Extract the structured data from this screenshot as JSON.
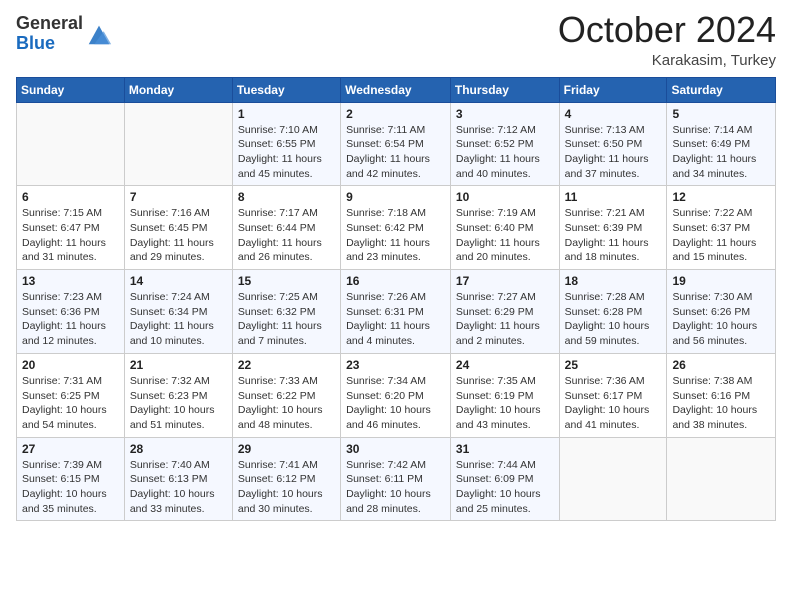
{
  "logo": {
    "line1": "General",
    "line2": "Blue"
  },
  "header": {
    "month": "October 2024",
    "location": "Karakasim, Turkey"
  },
  "days_of_week": [
    "Sunday",
    "Monday",
    "Tuesday",
    "Wednesday",
    "Thursday",
    "Friday",
    "Saturday"
  ],
  "weeks": [
    [
      {
        "day": "",
        "info": ""
      },
      {
        "day": "",
        "info": ""
      },
      {
        "day": "1",
        "info": "Sunrise: 7:10 AM\nSunset: 6:55 PM\nDaylight: 11 hours and 45 minutes."
      },
      {
        "day": "2",
        "info": "Sunrise: 7:11 AM\nSunset: 6:54 PM\nDaylight: 11 hours and 42 minutes."
      },
      {
        "day": "3",
        "info": "Sunrise: 7:12 AM\nSunset: 6:52 PM\nDaylight: 11 hours and 40 minutes."
      },
      {
        "day": "4",
        "info": "Sunrise: 7:13 AM\nSunset: 6:50 PM\nDaylight: 11 hours and 37 minutes."
      },
      {
        "day": "5",
        "info": "Sunrise: 7:14 AM\nSunset: 6:49 PM\nDaylight: 11 hours and 34 minutes."
      }
    ],
    [
      {
        "day": "6",
        "info": "Sunrise: 7:15 AM\nSunset: 6:47 PM\nDaylight: 11 hours and 31 minutes."
      },
      {
        "day": "7",
        "info": "Sunrise: 7:16 AM\nSunset: 6:45 PM\nDaylight: 11 hours and 29 minutes."
      },
      {
        "day": "8",
        "info": "Sunrise: 7:17 AM\nSunset: 6:44 PM\nDaylight: 11 hours and 26 minutes."
      },
      {
        "day": "9",
        "info": "Sunrise: 7:18 AM\nSunset: 6:42 PM\nDaylight: 11 hours and 23 minutes."
      },
      {
        "day": "10",
        "info": "Sunrise: 7:19 AM\nSunset: 6:40 PM\nDaylight: 11 hours and 20 minutes."
      },
      {
        "day": "11",
        "info": "Sunrise: 7:21 AM\nSunset: 6:39 PM\nDaylight: 11 hours and 18 minutes."
      },
      {
        "day": "12",
        "info": "Sunrise: 7:22 AM\nSunset: 6:37 PM\nDaylight: 11 hours and 15 minutes."
      }
    ],
    [
      {
        "day": "13",
        "info": "Sunrise: 7:23 AM\nSunset: 6:36 PM\nDaylight: 11 hours and 12 minutes."
      },
      {
        "day": "14",
        "info": "Sunrise: 7:24 AM\nSunset: 6:34 PM\nDaylight: 11 hours and 10 minutes."
      },
      {
        "day": "15",
        "info": "Sunrise: 7:25 AM\nSunset: 6:32 PM\nDaylight: 11 hours and 7 minutes."
      },
      {
        "day": "16",
        "info": "Sunrise: 7:26 AM\nSunset: 6:31 PM\nDaylight: 11 hours and 4 minutes."
      },
      {
        "day": "17",
        "info": "Sunrise: 7:27 AM\nSunset: 6:29 PM\nDaylight: 11 hours and 2 minutes."
      },
      {
        "day": "18",
        "info": "Sunrise: 7:28 AM\nSunset: 6:28 PM\nDaylight: 10 hours and 59 minutes."
      },
      {
        "day": "19",
        "info": "Sunrise: 7:30 AM\nSunset: 6:26 PM\nDaylight: 10 hours and 56 minutes."
      }
    ],
    [
      {
        "day": "20",
        "info": "Sunrise: 7:31 AM\nSunset: 6:25 PM\nDaylight: 10 hours and 54 minutes."
      },
      {
        "day": "21",
        "info": "Sunrise: 7:32 AM\nSunset: 6:23 PM\nDaylight: 10 hours and 51 minutes."
      },
      {
        "day": "22",
        "info": "Sunrise: 7:33 AM\nSunset: 6:22 PM\nDaylight: 10 hours and 48 minutes."
      },
      {
        "day": "23",
        "info": "Sunrise: 7:34 AM\nSunset: 6:20 PM\nDaylight: 10 hours and 46 minutes."
      },
      {
        "day": "24",
        "info": "Sunrise: 7:35 AM\nSunset: 6:19 PM\nDaylight: 10 hours and 43 minutes."
      },
      {
        "day": "25",
        "info": "Sunrise: 7:36 AM\nSunset: 6:17 PM\nDaylight: 10 hours and 41 minutes."
      },
      {
        "day": "26",
        "info": "Sunrise: 7:38 AM\nSunset: 6:16 PM\nDaylight: 10 hours and 38 minutes."
      }
    ],
    [
      {
        "day": "27",
        "info": "Sunrise: 7:39 AM\nSunset: 6:15 PM\nDaylight: 10 hours and 35 minutes."
      },
      {
        "day": "28",
        "info": "Sunrise: 7:40 AM\nSunset: 6:13 PM\nDaylight: 10 hours and 33 minutes."
      },
      {
        "day": "29",
        "info": "Sunrise: 7:41 AM\nSunset: 6:12 PM\nDaylight: 10 hours and 30 minutes."
      },
      {
        "day": "30",
        "info": "Sunrise: 7:42 AM\nSunset: 6:11 PM\nDaylight: 10 hours and 28 minutes."
      },
      {
        "day": "31",
        "info": "Sunrise: 7:44 AM\nSunset: 6:09 PM\nDaylight: 10 hours and 25 minutes."
      },
      {
        "day": "",
        "info": ""
      },
      {
        "day": "",
        "info": ""
      }
    ]
  ]
}
